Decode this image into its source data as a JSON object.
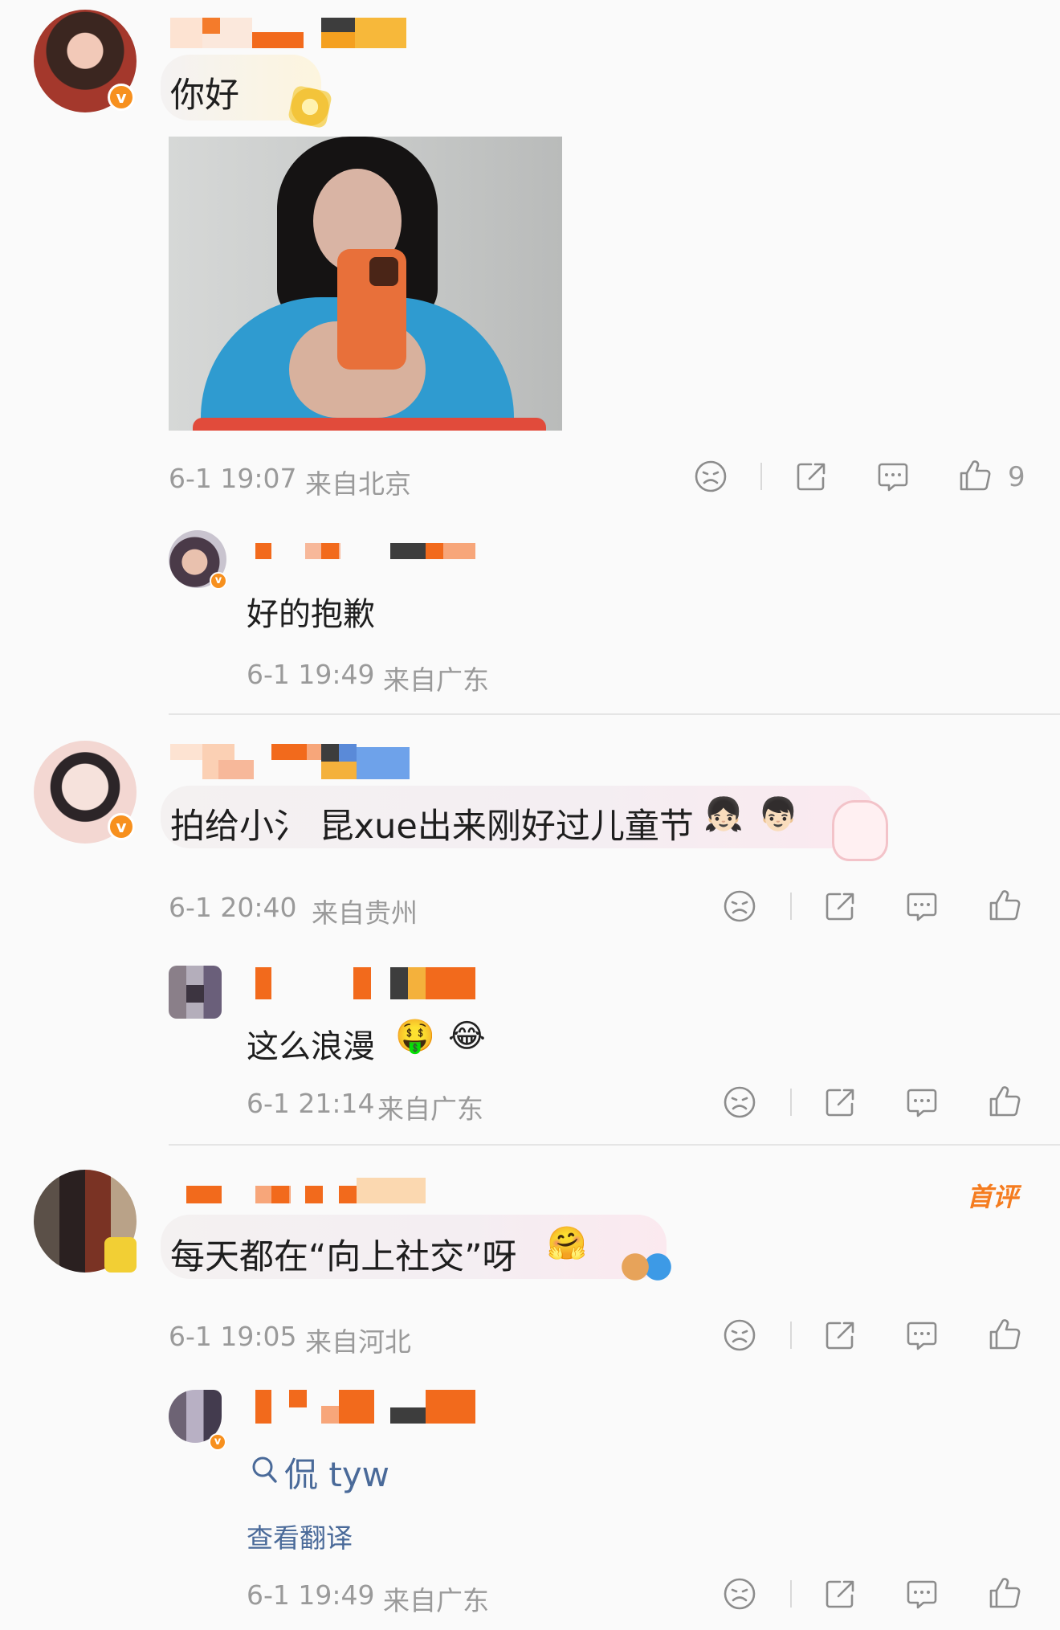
{
  "comments": [
    {
      "text": "你好",
      "timestamp": "6-1 19:07",
      "location": "来自北京",
      "like_count": "9",
      "reply": {
        "text": "好的抱歉",
        "timestamp": "6-1 19:49",
        "location": "来自广东"
      }
    },
    {
      "text": "拍给小氵 昆xue出来刚好过儿童节",
      "emoji_1": "👧🏻",
      "emoji_2": "👦🏻",
      "timestamp": "6-1 20:40",
      "location": "来自贵州",
      "like_count": "",
      "reply": {
        "text": "这么浪漫",
        "emoji_1": "🤑",
        "emoji_2": "😂",
        "timestamp": "6-1 21:14",
        "location": "来自广东"
      }
    },
    {
      "text": "每天都在“向上社交”呀",
      "emoji_1": "🤗",
      "first_comment_tag": "首评",
      "timestamp": "6-1 19:05",
      "location": "来自河北",
      "like_count": "",
      "reply": {
        "search_link": "侃 tyw",
        "translate_label": "查看翻译",
        "timestamp": "6-1 19:49",
        "location": "来自广东"
      }
    }
  ],
  "colors": {
    "accent_orange": "#f57c1f",
    "meta_gray": "#9a9a9a",
    "link_blue": "#4a6a99",
    "badge_orange": "#f7901e"
  },
  "icons": {
    "dislike": "sad-face-icon",
    "share": "share-icon",
    "comment": "comment-icon",
    "like": "thumbs-up-icon",
    "search": "search-icon"
  }
}
